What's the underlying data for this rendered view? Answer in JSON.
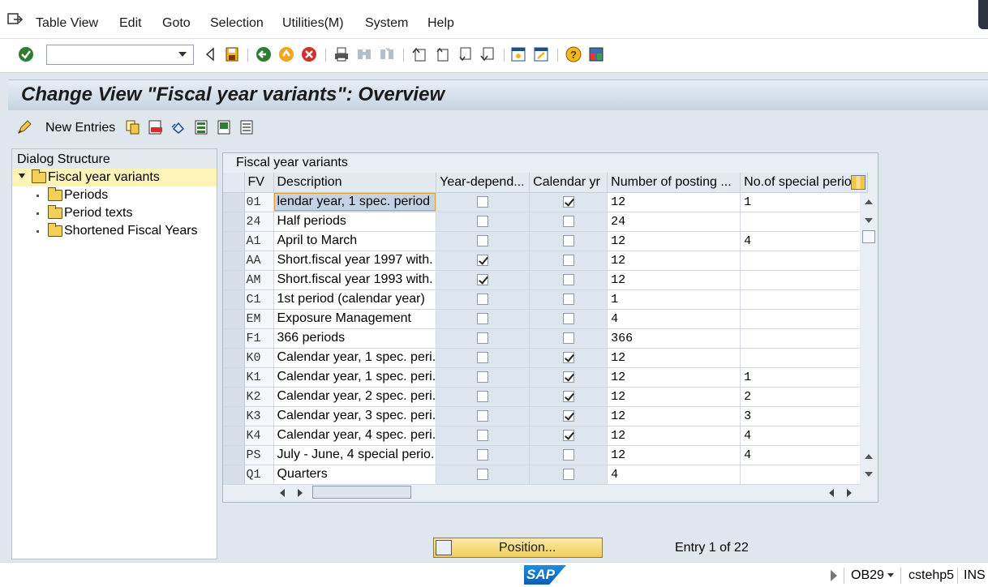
{
  "menu": [
    "Table View",
    "Edit",
    "Goto",
    "Selection",
    "Utilities(M)",
    "System",
    "Help"
  ],
  "toolbar": {
    "command_value": ""
  },
  "title": "Change View \"Fiscal year variants\": Overview",
  "app_toolbar": {
    "new_entries": "New Entries"
  },
  "dialog_structure": {
    "header": "Dialog Structure",
    "items": [
      {
        "label": "Fiscal year variants",
        "selected": true
      },
      {
        "label": "Periods"
      },
      {
        "label": "Period texts"
      },
      {
        "label": "Shortened Fiscal Years"
      }
    ]
  },
  "table": {
    "caption": "Fiscal year variants",
    "columns": [
      "FV",
      "Description",
      "Year-depend...",
      "Calendar yr",
      "Number of posting ...",
      "No.of special periods"
    ],
    "rows": [
      {
        "fv": "01",
        "desc": "lendar year, 1 spec. period",
        "year_dep": false,
        "cal_yr": true,
        "posting": "12",
        "special": "1"
      },
      {
        "fv": "24",
        "desc": "Half periods",
        "year_dep": false,
        "cal_yr": false,
        "posting": "24",
        "special": ""
      },
      {
        "fv": "A1",
        "desc": "April to March",
        "year_dep": false,
        "cal_yr": false,
        "posting": "12",
        "special": "4"
      },
      {
        "fv": "AA",
        "desc": "Short.fiscal year 1997 with.",
        "year_dep": true,
        "cal_yr": false,
        "posting": "12",
        "special": ""
      },
      {
        "fv": "AM",
        "desc": "Short.fiscal year 1993 with.",
        "year_dep": true,
        "cal_yr": false,
        "posting": "12",
        "special": ""
      },
      {
        "fv": "C1",
        "desc": "1st period (calendar year)",
        "year_dep": false,
        "cal_yr": false,
        "posting": "1",
        "special": ""
      },
      {
        "fv": "EM",
        "desc": "Exposure Management",
        "year_dep": false,
        "cal_yr": false,
        "posting": "4",
        "special": ""
      },
      {
        "fv": "F1",
        "desc": "366 periods",
        "year_dep": false,
        "cal_yr": false,
        "posting": "366",
        "special": ""
      },
      {
        "fv": "K0",
        "desc": "Calendar year, 1 spec. peri.",
        "year_dep": false,
        "cal_yr": true,
        "posting": "12",
        "special": ""
      },
      {
        "fv": "K1",
        "desc": "Calendar year, 1 spec. peri.",
        "year_dep": false,
        "cal_yr": true,
        "posting": "12",
        "special": "1"
      },
      {
        "fv": "K2",
        "desc": "Calendar year, 2 spec. peri.",
        "year_dep": false,
        "cal_yr": true,
        "posting": "12",
        "special": "2"
      },
      {
        "fv": "K3",
        "desc": "Calendar year, 3 spec. peri.",
        "year_dep": false,
        "cal_yr": true,
        "posting": "12",
        "special": "3"
      },
      {
        "fv": "K4",
        "desc": "Calendar year, 4 spec. peri.",
        "year_dep": false,
        "cal_yr": true,
        "posting": "12",
        "special": "4"
      },
      {
        "fv": "PS",
        "desc": "July - June, 4 special perio.",
        "year_dep": false,
        "cal_yr": false,
        "posting": "12",
        "special": "4"
      },
      {
        "fv": "Q1",
        "desc": "Quarters",
        "year_dep": false,
        "cal_yr": false,
        "posting": "4",
        "special": ""
      }
    ]
  },
  "position_button": "Position...",
  "entry_info": "Entry 1 of 22",
  "status": {
    "logo": "SAP",
    "tcode": "OB29",
    "server": "cstehp5",
    "mode": "INS"
  },
  "colors": {
    "selected_tree": "#fff3b8",
    "title_gradient_top": "#e7eef5",
    "button_yellow": "#f1cd5a"
  }
}
